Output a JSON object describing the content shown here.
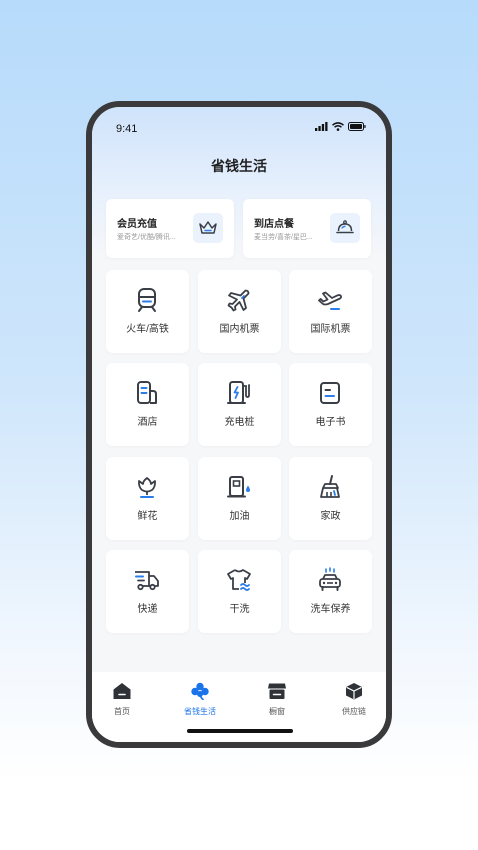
{
  "status_bar": {
    "time": "9:41",
    "icons": [
      "signal-icon",
      "wifi-icon",
      "battery-icon"
    ]
  },
  "page": {
    "title": "省钱生活"
  },
  "promos": [
    {
      "title": "会员充值",
      "subtitle": "爱奇艺/优酷/腾讯...",
      "icon": "crown-icon"
    },
    {
      "title": "到店点餐",
      "subtitle": "麦当劳/喜茶/星巴...",
      "icon": "food-cloche-icon"
    }
  ],
  "services": [
    {
      "label": "火车/高铁",
      "icon": "train-icon"
    },
    {
      "label": "国内机票",
      "icon": "airplane-icon"
    },
    {
      "label": "国际机票",
      "icon": "airplane-takeoff-icon"
    },
    {
      "label": "酒店",
      "icon": "hotel-icon"
    },
    {
      "label": "充电桩",
      "icon": "charging-station-icon"
    },
    {
      "label": "电子书",
      "icon": "ebook-icon"
    },
    {
      "label": "鲜花",
      "icon": "flower-icon"
    },
    {
      "label": "加油",
      "icon": "fuel-pump-icon"
    },
    {
      "label": "家政",
      "icon": "broom-icon"
    },
    {
      "label": "快递",
      "icon": "delivery-truck-icon"
    },
    {
      "label": "干洗",
      "icon": "dry-cleaning-icon"
    },
    {
      "label": "洗车保养",
      "icon": "car-wash-icon"
    }
  ],
  "tabs": [
    {
      "label": "首页",
      "icon": "home-icon",
      "active": false
    },
    {
      "label": "省钱生活",
      "icon": "clover-icon",
      "active": true
    },
    {
      "label": "橱窗",
      "icon": "store-icon",
      "active": false
    },
    {
      "label": "供应链",
      "icon": "box-icon",
      "active": false
    }
  ],
  "colors": {
    "accent": "#1a73e8",
    "icon_dark": "#3a3f47",
    "icon_blue": "#2b7de9"
  }
}
